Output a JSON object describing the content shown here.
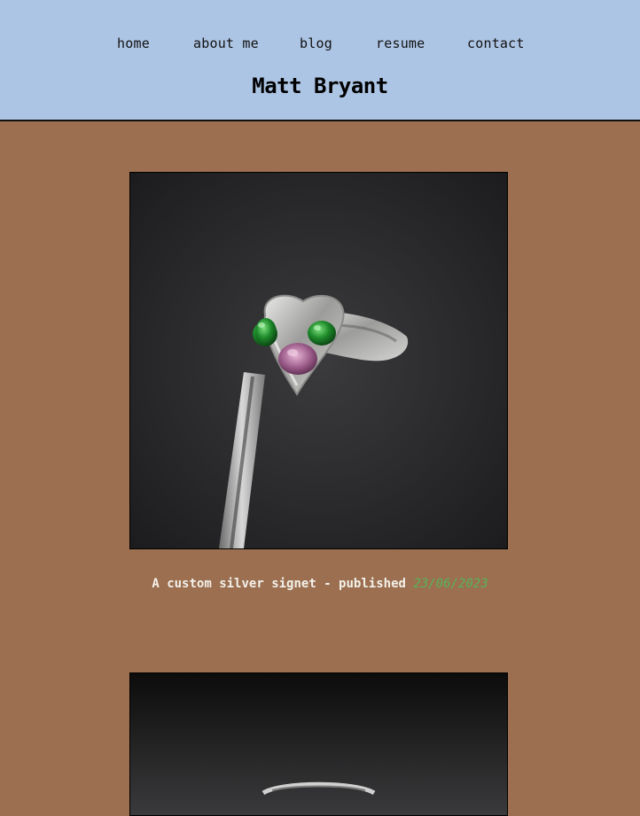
{
  "nav": {
    "items": [
      {
        "label": "home"
      },
      {
        "label": "about me"
      },
      {
        "label": "blog"
      },
      {
        "label": "resume"
      },
      {
        "label": "contact"
      }
    ]
  },
  "site": {
    "title": "Matt Bryant"
  },
  "posts": [
    {
      "caption": "A custom silver signet - published",
      "date": "23/06/2023"
    }
  ],
  "colors": {
    "header_bg": "#adc5e4",
    "page_bg": "#9b6f50",
    "date_accent": "#56b45a",
    "caption_text": "#f4f1ea"
  }
}
